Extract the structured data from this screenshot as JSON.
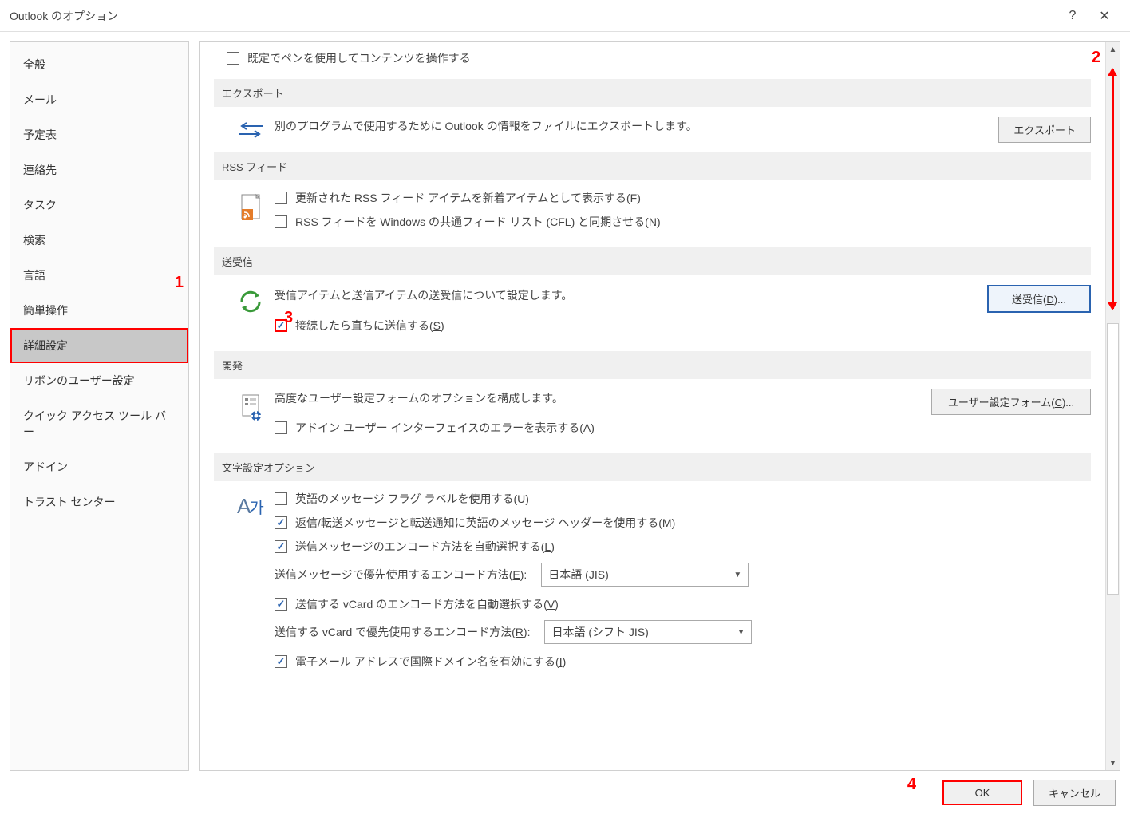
{
  "window": {
    "title": "Outlook のオプション"
  },
  "sidebar": {
    "items": [
      {
        "label": "全般"
      },
      {
        "label": "メール"
      },
      {
        "label": "予定表"
      },
      {
        "label": "連絡先"
      },
      {
        "label": "タスク"
      },
      {
        "label": "検索"
      },
      {
        "label": "言語"
      },
      {
        "label": "簡単操作"
      },
      {
        "label": "詳細設定"
      },
      {
        "label": "リボンのユーザー設定"
      },
      {
        "label": "クイック アクセス ツール バー"
      },
      {
        "label": "アドイン"
      },
      {
        "label": "トラスト センター"
      }
    ],
    "active_index": 8
  },
  "top_checkbox": {
    "label": "既定でペンを使用してコンテンツを操作する"
  },
  "sections": {
    "export": {
      "header": "エクスポート",
      "desc": "別のプログラムで使用するために Outlook の情報をファイルにエクスポートします。",
      "button": "エクスポート"
    },
    "rss": {
      "header": "RSS フィード",
      "cb1": "更新された RSS フィード アイテムを新着アイテムとして表示する",
      "cb1_key": "F",
      "cb2": "RSS フィードを Windows の共通フィード リスト (CFL) と同期させる",
      "cb2_key": "N"
    },
    "sendrecv": {
      "header": "送受信",
      "desc": "受信アイテムと送信アイテムの送受信について設定します。",
      "button": "送受信",
      "button_key": "D",
      "button_suffix": "...",
      "cb1": "接続したら直ちに送信する",
      "cb1_key": "S"
    },
    "dev": {
      "header": "開発",
      "desc": "高度なユーザー設定フォームのオプションを構成します。",
      "button": "ユーザー設定フォーム",
      "button_key": "C",
      "button_suffix": "...",
      "cb1": "アドイン ユーザー インターフェイスのエラーを表示する",
      "cb1_key": "A"
    },
    "intl": {
      "header": "文字設定オプション",
      "cb1": "英語のメッセージ フラグ ラベルを使用する",
      "cb1_key": "U",
      "cb2": "返信/転送メッセージと転送通知に英語のメッセージ ヘッダーを使用する",
      "cb2_key": "M",
      "cb3": "送信メッセージのエンコード方法を自動選択する",
      "cb3_key": "L",
      "enc_out_label": "送信メッセージで優先使用するエンコード方法",
      "enc_out_key": "E",
      "enc_out_value": "日本語 (JIS)",
      "cb4": "送信する vCard のエンコード方法を自動選択する",
      "cb4_key": "V",
      "vcard_label": "送信する vCard で優先使用するエンコード方法",
      "vcard_key": "R",
      "vcard_value": "日本語 (シフト JIS)",
      "cb5": "電子メール アドレスで国際ドメイン名を有効にする",
      "cb5_key": "I"
    }
  },
  "footer": {
    "ok": "OK",
    "cancel": "キャンセル"
  },
  "annotations": {
    "n1": "1",
    "n2": "2",
    "n3": "3",
    "n4": "4"
  }
}
